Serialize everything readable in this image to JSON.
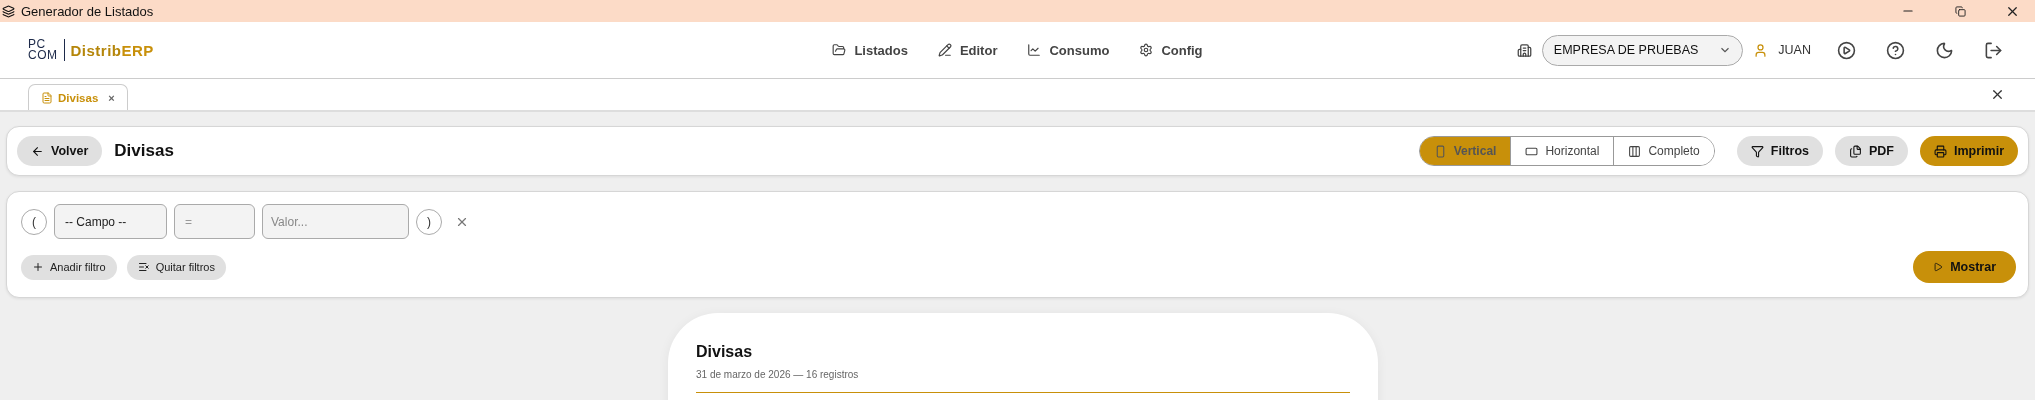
{
  "window": {
    "title": "Generador de Listados"
  },
  "header": {
    "logo": {
      "top": "PC",
      "bottom": "COM",
      "brand": "Distrib",
      "brand_accent": "ERP"
    },
    "nav": [
      {
        "label": "Listados"
      },
      {
        "label": "Editor"
      },
      {
        "label": "Consumo"
      },
      {
        "label": "Config"
      }
    ],
    "company": "EMPRESA DE PRUEBAS",
    "user": "JUAN"
  },
  "tabs": [
    {
      "label": "Divisas",
      "selected": true,
      "close": "×"
    }
  ],
  "toolbar": {
    "back": "Volver",
    "title": "Divisas",
    "modes": [
      {
        "label": "Vertical",
        "selected": true
      },
      {
        "label": "Horizontal",
        "selected": false
      },
      {
        "label": "Completo",
        "selected": false
      }
    ],
    "actions": [
      {
        "label": "Filtros",
        "kind": "secondary"
      },
      {
        "label": "PDF",
        "kind": "secondary"
      },
      {
        "label": "Imprimir",
        "kind": "primary"
      }
    ]
  },
  "filters": {
    "open_paren": "(",
    "field": "-- Campo --",
    "operator": "=",
    "value_placeholder": "Valor...",
    "close_paren": ")",
    "add": "Anadir filtro",
    "clear": "Quitar filtros",
    "show": "Mostrar"
  },
  "report": {
    "title": "Divisas",
    "subtitle": "31 de marzo de 2026 — 16 registros"
  }
}
